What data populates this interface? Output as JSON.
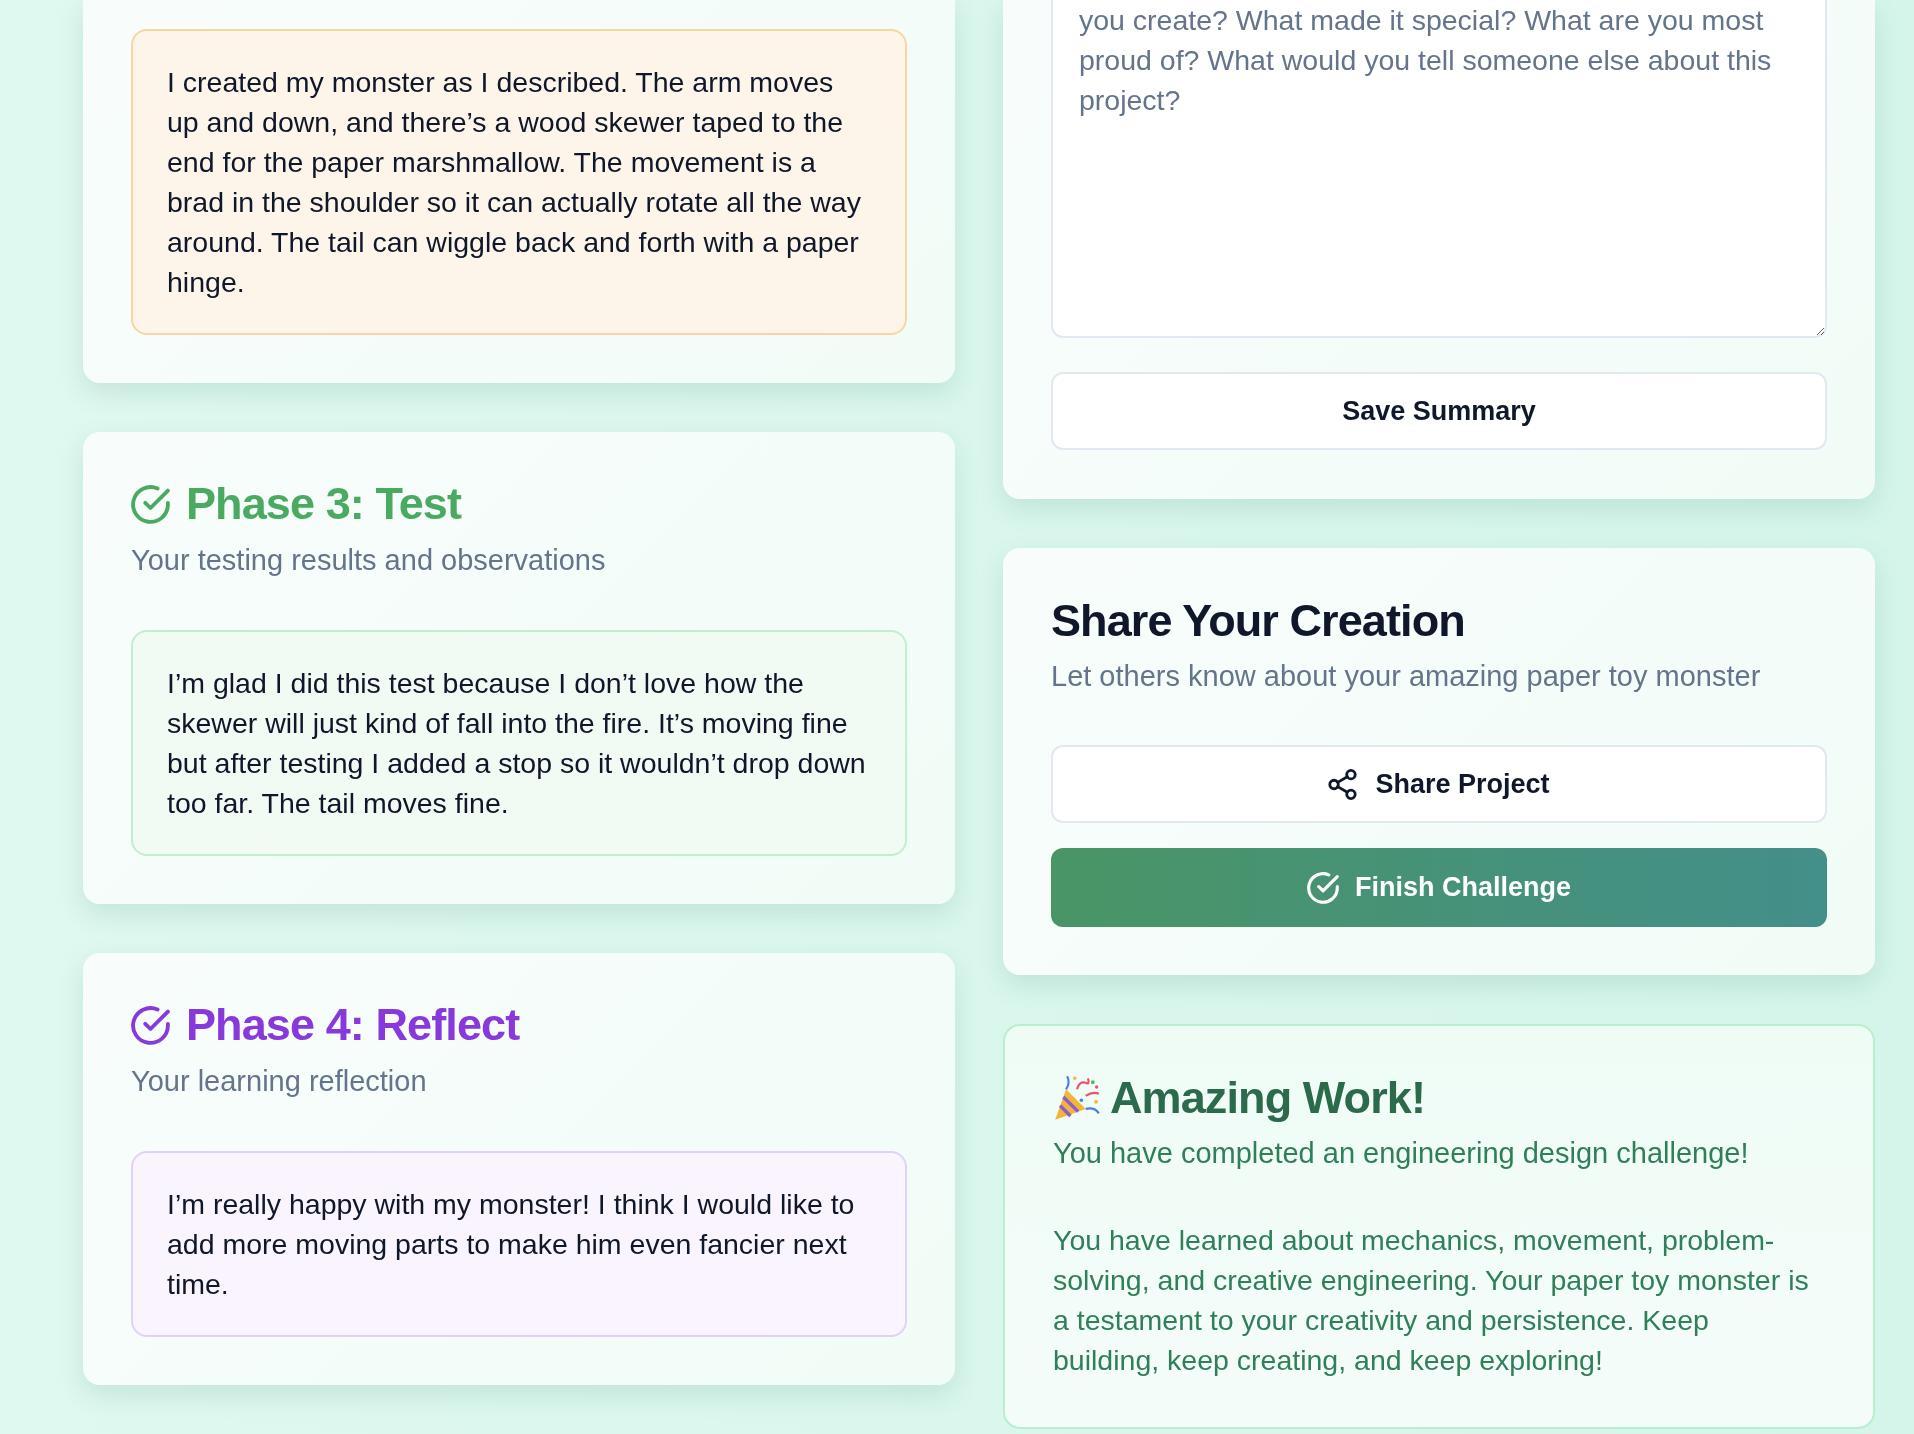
{
  "phases": [
    {
      "response": "I created my monster as I described. The arm moves up and down, and there’s a wood skewer taped to the end for the paper marshmallow. The movement is a brad in the shoulder so it can actually rotate all the way around. The tail can wiggle back and forth with a paper hinge.",
      "color": "#f7d5a5"
    },
    {
      "title": "Phase 3: Test",
      "subtitle": "Your testing results and observations",
      "response": "I’m glad I did this test because I don’t love how the skewer will just kind of fall into the fire. It’s moving fine but after testing I added a stop so it wouldn’t drop down too far. The tail moves fine.",
      "color": "#c3eecd"
    },
    {
      "title": "Phase 4: Reflect",
      "subtitle": "Your learning reflection",
      "response": "I’m really happy with my monster! I think I would like to add more moving parts to make him even fancier next time.",
      "color": "#e3d0f8"
    }
  ],
  "summary": {
    "placeholder": "you create? What made it special? What are you most proud of? What would you tell someone else about this project?",
    "save_button": "Save Summary"
  },
  "share": {
    "title": "Share Your Creation",
    "subtitle": "Let others know about your amazing paper toy monster",
    "share_button": "Share Project",
    "finish_button": "Finish Challenge"
  },
  "celebration": {
    "title": "Amazing Work!",
    "subtitle": "You have completed an engineering design challenge!",
    "message": "You have learned about mechanics, movement, problem-solving, and creative engineering. Your paper toy monster is a testament to your creativity and persistence. Keep building, keep creating, and keep exploring!"
  }
}
